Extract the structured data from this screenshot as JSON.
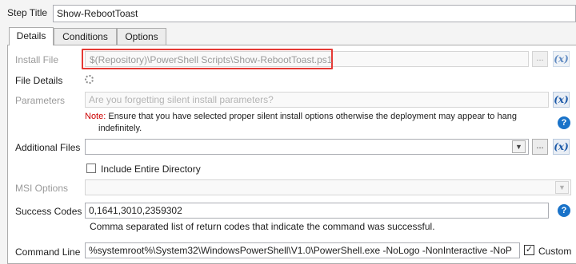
{
  "step_title": {
    "label": "Step Title",
    "value": "Show-RebootToast"
  },
  "tabs": [
    {
      "label": "Details"
    },
    {
      "label": "Conditions"
    },
    {
      "label": "Options"
    }
  ],
  "install_file": {
    "label": "Install File",
    "value": "$(Repository)\\PowerShell Scripts\\Show-RebootToast.ps1",
    "browse": "...",
    "variable": "(x)"
  },
  "file_details": {
    "label": "File Details"
  },
  "parameters": {
    "label": "Parameters",
    "placeholder": "Are you forgetting silent install parameters?",
    "variable": "(x)"
  },
  "note": {
    "prefix": "Note:",
    "line1": " Ensure that you have selected proper silent install options otherwise the deployment may appear to hang",
    "line2": "indefinitely.",
    "help": "?"
  },
  "additional_files": {
    "label": "Additional Files",
    "browse": "...",
    "variable": "(x)"
  },
  "include_entire_directory": {
    "label": "Include Entire Directory",
    "checked": false
  },
  "msi_options": {
    "label": "MSI Options"
  },
  "success_codes": {
    "label": "Success Codes",
    "value": "0,1641,3010,2359302",
    "hint": "Comma separated list of return codes that indicate the command was successful.",
    "help": "?"
  },
  "command_line": {
    "label": "Command Line",
    "value": "%systemroot%\\System32\\WindowsPowerShell\\V1.0\\PowerShell.exe -NoLogo -NonInteractive -NoP",
    "custom_label": "Custom",
    "custom_checked": true
  },
  "colors": {
    "highlight": "#e53935",
    "accent": "#1a73c9",
    "note": "#cc0000"
  }
}
